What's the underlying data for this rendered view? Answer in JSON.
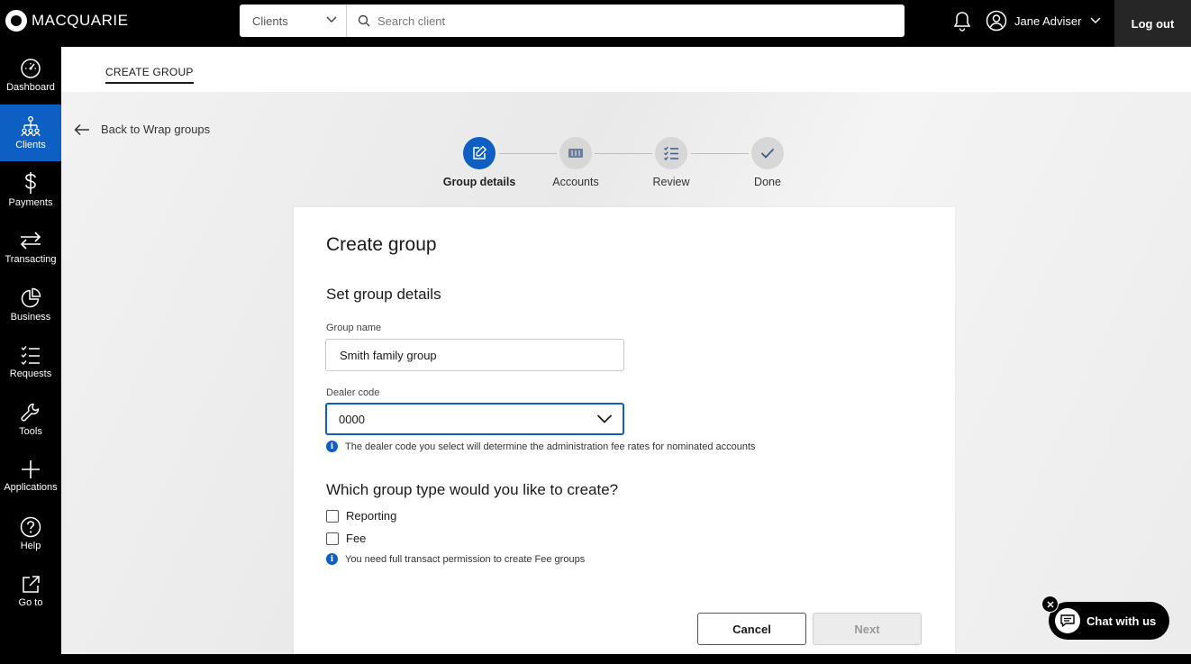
{
  "brand": {
    "name": "MACQUARIE"
  },
  "search": {
    "scope": "Clients",
    "placeholder": "Search client",
    "value": ""
  },
  "user": {
    "name": "Jane Adviser"
  },
  "header": {
    "logout_label": "Log out"
  },
  "sidebar": {
    "items": [
      {
        "label": "Dashboard",
        "icon": "dashboard-icon",
        "active": false
      },
      {
        "label": "Clients",
        "icon": "clients-icon",
        "active": true
      },
      {
        "label": "Payments",
        "icon": "dollar-icon",
        "active": false
      },
      {
        "label": "Transacting",
        "icon": "transfer-arrows-icon",
        "active": false
      },
      {
        "label": "Business",
        "icon": "pie-chart-icon",
        "active": false
      },
      {
        "label": "Requests",
        "icon": "checklist-icon",
        "active": false
      },
      {
        "label": "Tools",
        "icon": "wrench-icon",
        "active": false
      },
      {
        "label": "Applications",
        "icon": "plus-icon",
        "active": false
      },
      {
        "label": "Help",
        "icon": "help-icon",
        "active": false
      },
      {
        "label": "Go to",
        "icon": "external-link-icon",
        "active": false
      }
    ]
  },
  "subheader": {
    "tab": "CREATE GROUP"
  },
  "back_link": "Back to Wrap groups",
  "stepper": {
    "steps": [
      {
        "label": "Group details",
        "icon": "edit-icon",
        "state": "active"
      },
      {
        "label": "Accounts",
        "icon": "accounts-icon",
        "state": "pending"
      },
      {
        "label": "Review",
        "icon": "checklist-icon",
        "state": "pending"
      },
      {
        "label": "Done",
        "icon": "check-icon",
        "state": "pending"
      }
    ]
  },
  "form": {
    "title": "Create group",
    "section_title": "Set group details",
    "group_name": {
      "label": "Group name",
      "value": "Smith family group"
    },
    "dealer_code": {
      "label": "Dealer code",
      "value": "0000",
      "info": "The dealer code you select will determine the administration fee rates for nominated accounts"
    },
    "group_type": {
      "question": "Which group type would you like to create?",
      "options": [
        {
          "label": "Reporting",
          "checked": false
        },
        {
          "label": "Fee",
          "checked": false
        }
      ],
      "info": "You need full transact permission to create Fee groups"
    },
    "cancel_label": "Cancel",
    "next_label": "Next"
  },
  "chat": {
    "label": "Chat with us"
  },
  "colors": {
    "accent": "#0d5fc4",
    "topbar": "#000000",
    "logout_bg": "#262626"
  }
}
